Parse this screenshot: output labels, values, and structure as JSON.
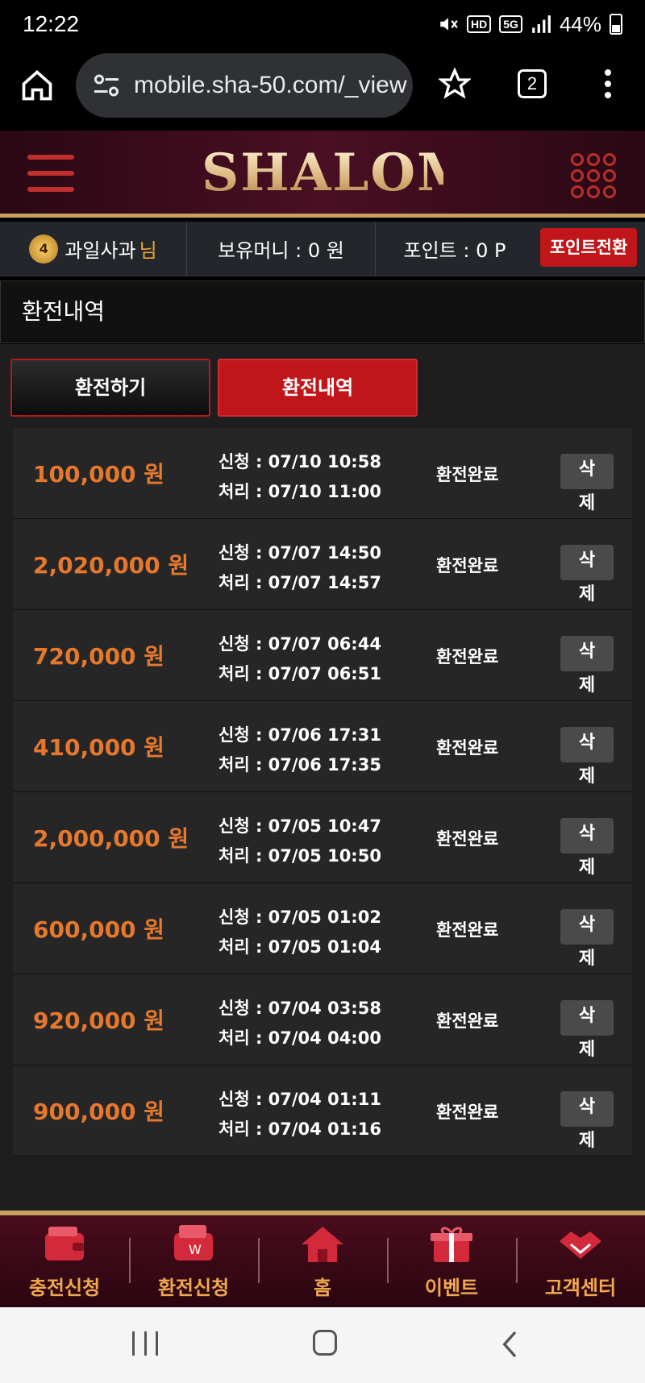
{
  "status_bar": {
    "time": "12:22",
    "network": "5G",
    "hd": "HD",
    "battery": "44%"
  },
  "browser": {
    "url": "mobile.sha-50.com/_view",
    "tab_count": "2"
  },
  "header": {
    "logo": "SHALOM"
  },
  "user_bar": {
    "level": "4",
    "username": "과일사과",
    "honorific": "님",
    "money": "보유머니 : 0 원",
    "points": "포인트 : 0 P",
    "convert_button": "포인트전환"
  },
  "section_title": "환전내역",
  "tabs": {
    "exchange": "환전하기",
    "history": "환전내역"
  },
  "records": [
    {
      "amount": "100,000 원",
      "request": "신청 : 07/10 10:58",
      "processed": "처리 : 07/10 11:00",
      "status": "환전완료",
      "delete_a": "삭",
      "delete_b": "제"
    },
    {
      "amount": "2,020,000 원",
      "request": "신청 : 07/07 14:50",
      "processed": "처리 : 07/07 14:57",
      "status": "환전완료",
      "delete_a": "삭",
      "delete_b": "제"
    },
    {
      "amount": "720,000 원",
      "request": "신청 : 07/07 06:44",
      "processed": "처리 : 07/07 06:51",
      "status": "환전완료",
      "delete_a": "삭",
      "delete_b": "제"
    },
    {
      "amount": "410,000 원",
      "request": "신청 : 07/06 17:31",
      "processed": "처리 : 07/06 17:35",
      "status": "환전완료",
      "delete_a": "삭",
      "delete_b": "제"
    },
    {
      "amount": "2,000,000 원",
      "request": "신청 : 07/05 10:47",
      "processed": "처리 : 07/05 10:50",
      "status": "환전완료",
      "delete_a": "삭",
      "delete_b": "제"
    },
    {
      "amount": "600,000 원",
      "request": "신청 : 07/05 01:02",
      "processed": "처리 : 07/05 01:04",
      "status": "환전완료",
      "delete_a": "삭",
      "delete_b": "제"
    },
    {
      "amount": "920,000 원",
      "request": "신청 : 07/04 03:58",
      "processed": "처리 : 07/04 04:00",
      "status": "환전완료",
      "delete_a": "삭",
      "delete_b": "제"
    },
    {
      "amount": "900,000 원",
      "request": "신청 : 07/04 01:11",
      "processed": "처리 : 07/04 01:16",
      "status": "환전완료",
      "delete_a": "삭",
      "delete_b": "제"
    }
  ],
  "bottom_nav": [
    {
      "label": "충전신청",
      "icon": "wallet-icon"
    },
    {
      "label": "환전신청",
      "icon": "money-wallet-icon"
    },
    {
      "label": "홈",
      "icon": "house-icon"
    },
    {
      "label": "이벤트",
      "icon": "gift-icon"
    },
    {
      "label": "고객센터",
      "icon": "handshake-icon"
    }
  ],
  "colors": {
    "accent_red": "#c0161a",
    "amount_orange": "#e6782e",
    "gold": "#c8a060",
    "nav_label": "#f0a850"
  }
}
